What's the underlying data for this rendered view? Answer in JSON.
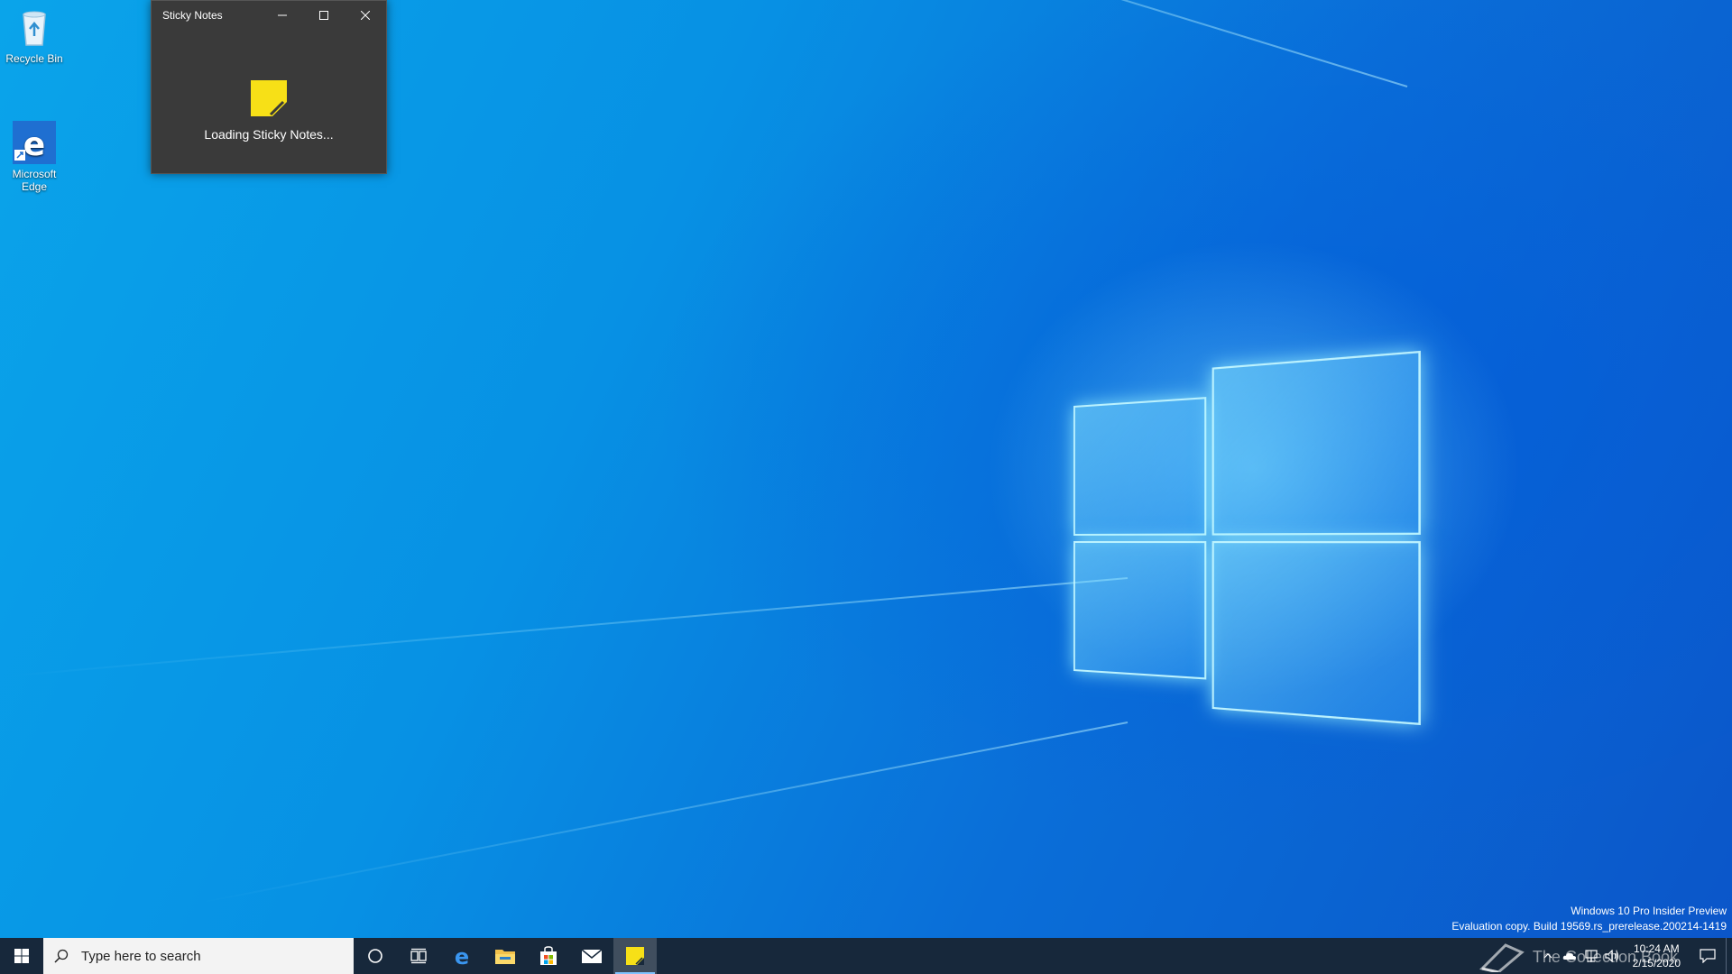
{
  "desktop": {
    "icons": [
      {
        "label": "Recycle Bin",
        "icon": "recycle-bin-icon"
      },
      {
        "label": "Microsoft\nEdge",
        "icon": "edge-icon"
      }
    ]
  },
  "sticky_window": {
    "title": "Sticky Notes",
    "loading_text": "Loading Sticky Notes...",
    "minimize_glyph": "—",
    "maximize_glyph": "☐",
    "close_glyph": "✕",
    "accent": "#f7e017"
  },
  "watermark": {
    "line1": "Windows 10 Pro Insider Preview",
    "line2": "Evaluation copy. Build 19569.rs_prerelease.200214-1419"
  },
  "taskbar": {
    "search_placeholder": "Type here to search",
    "pinned": [
      "cortana-icon",
      "task-view-icon",
      "edge-icon",
      "file-explorer-icon",
      "store-icon",
      "mail-icon",
      "sticky-notes-icon"
    ],
    "active_app": "sticky-notes-icon",
    "clock_time": "10:24 AM",
    "clock_date": "2/15/2020",
    "overlay_text": "The Collection Book",
    "background": "#17283b"
  }
}
